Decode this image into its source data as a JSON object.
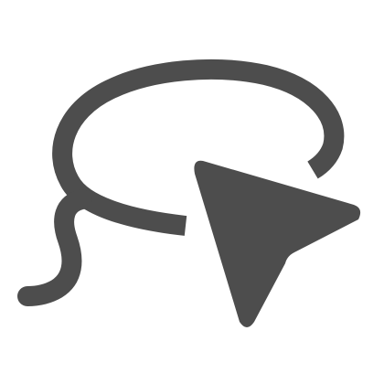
{
  "icon": {
    "name": "lasso-select-icon",
    "parts": [
      "lasso-loop",
      "lasso-tail",
      "cursor-arrow"
    ],
    "color": "#4d4d4d",
    "background": "#ffffff"
  }
}
